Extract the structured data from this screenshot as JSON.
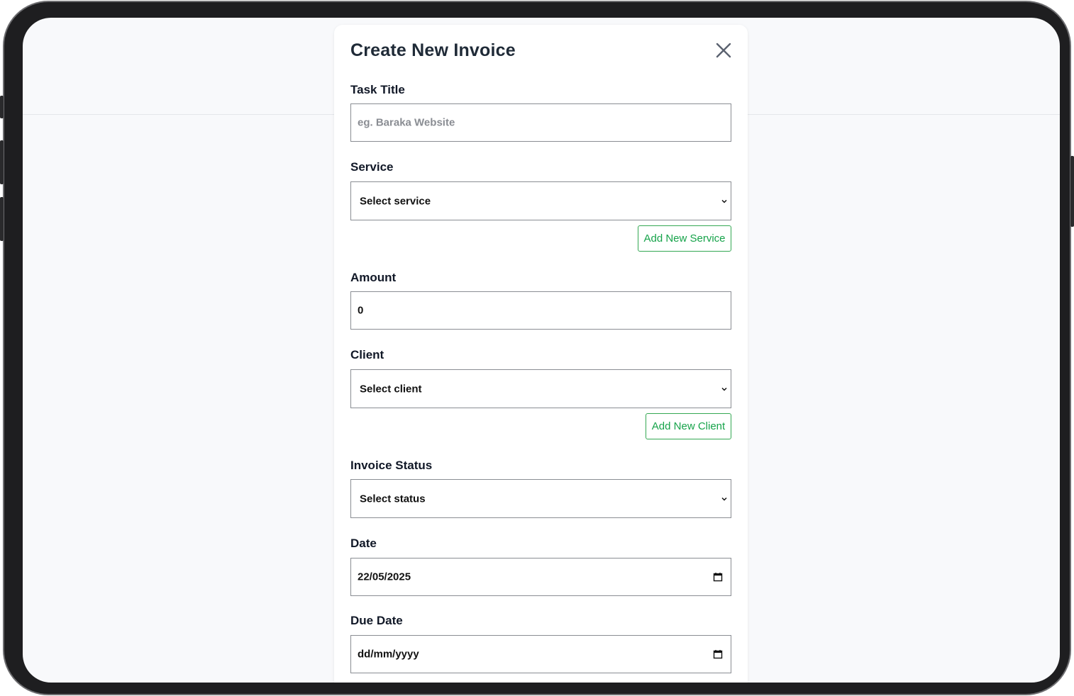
{
  "modal": {
    "title": "Create New Invoice",
    "close_icon": "close-icon"
  },
  "form": {
    "task_title": {
      "label": "Task Title",
      "placeholder": "eg. Baraka Website",
      "value": ""
    },
    "service": {
      "label": "Service",
      "selected": "Select service",
      "add_button": "Add New Service"
    },
    "amount": {
      "label": "Amount",
      "value": "0"
    },
    "client": {
      "label": "Client",
      "selected": "Select client",
      "add_button": "Add New Client"
    },
    "invoice_status": {
      "label": "Invoice Status",
      "selected": "Select status"
    },
    "date": {
      "label": "Date",
      "value": "22/05/2025"
    },
    "due_date": {
      "label": "Due Date",
      "value": "dd/mm/yyyy"
    }
  },
  "colors": {
    "accent_green": "#16a34a",
    "title_text": "#1f2a37",
    "border": "#8a8d93"
  }
}
